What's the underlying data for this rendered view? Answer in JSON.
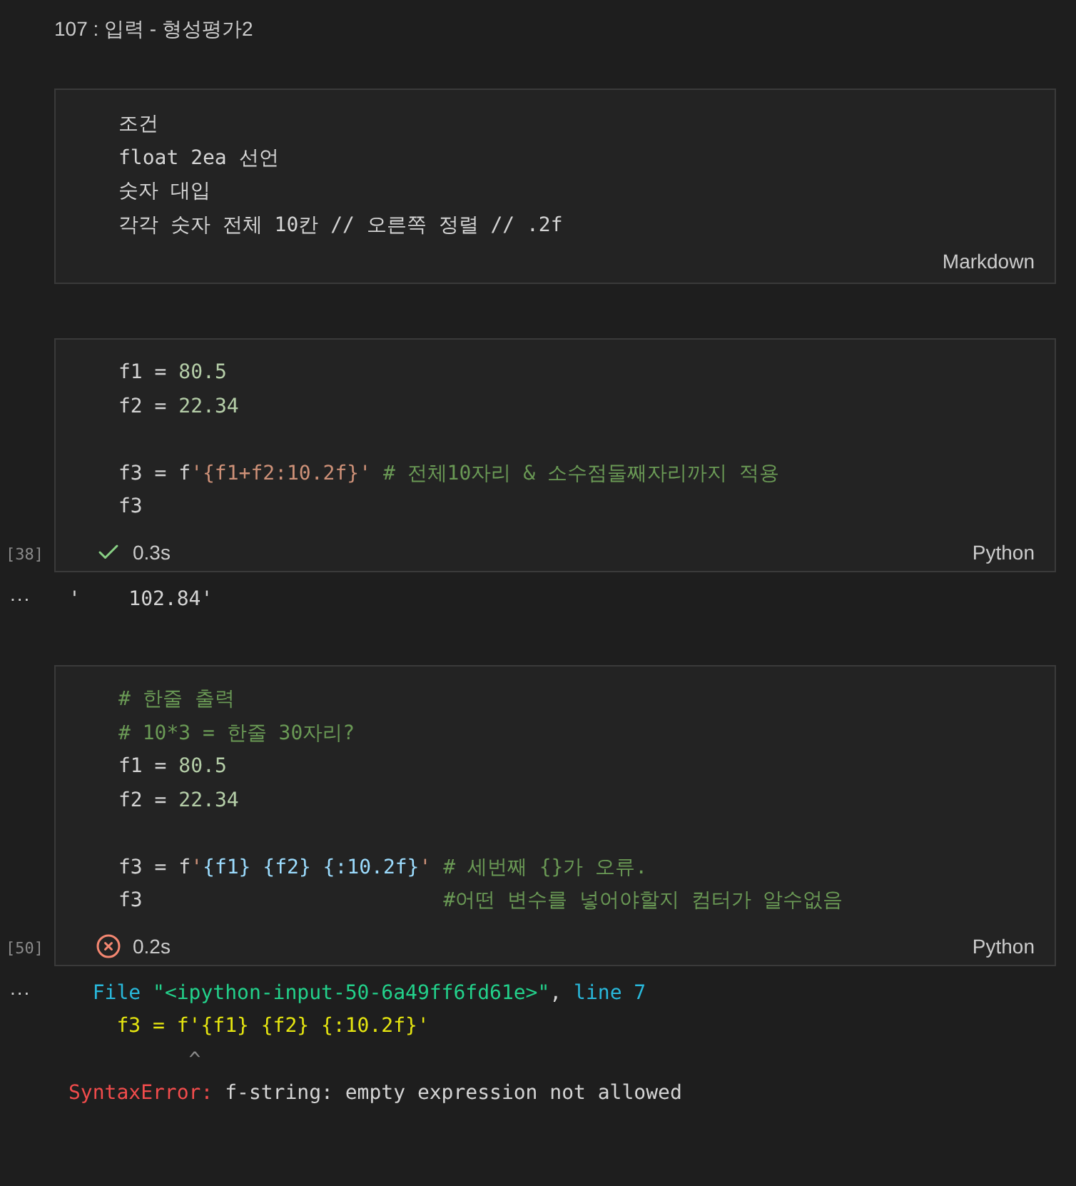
{
  "title": "107 : 입력 - 형성평가2",
  "cells": [
    {
      "kind": "markdown",
      "language": "Markdown",
      "lines": [
        {
          "kind": "code",
          "tokens": [
            {
              "kind": "text",
              "text": "조건"
            }
          ]
        },
        {
          "kind": "code",
          "tokens": [
            {
              "kind": "text",
              "text": "float 2ea 선언"
            }
          ]
        },
        {
          "kind": "code",
          "tokens": [
            {
              "kind": "text",
              "text": "숫자 대입"
            }
          ]
        },
        {
          "kind": "code",
          "tokens": [
            {
              "kind": "text",
              "text": "각각 숫자 전체 10칸 // 오른쪽 정렬 // .2f"
            }
          ]
        }
      ]
    },
    {
      "kind": "code",
      "language": "Python",
      "execution_count": "[38]",
      "result": {
        "kind": "success",
        "duration": "0.3s"
      },
      "lines": [
        {
          "kind": "code",
          "tokens": [
            {
              "kind": "text",
              "text": "f1 = "
            },
            {
              "kind": "number",
              "text": "80.5"
            }
          ]
        },
        {
          "kind": "code",
          "tokens": [
            {
              "kind": "text",
              "text": "f2 = "
            },
            {
              "kind": "number",
              "text": "22.34"
            }
          ]
        },
        {
          "kind": "blank"
        },
        {
          "kind": "code",
          "tokens": [
            {
              "kind": "text",
              "text": "f3 = f"
            },
            {
              "kind": "string",
              "text": "'{f1+f2:10.2f}' "
            },
            {
              "kind": "comment",
              "text": "# 전체10자리 & 소수점둘째자리까지 적용"
            }
          ]
        },
        {
          "kind": "code",
          "tokens": [
            {
              "kind": "text",
              "text": "f3"
            }
          ]
        }
      ],
      "output": {
        "marker": "...",
        "lines": [
          {
            "kind": "code",
            "tokens": [
              {
                "kind": "text",
                "text": "'    102.84'"
              }
            ]
          }
        ]
      }
    },
    {
      "kind": "code",
      "language": "Python",
      "execution_count": "[50]",
      "result": {
        "kind": "error",
        "duration": "0.2s"
      },
      "lines": [
        {
          "kind": "code",
          "tokens": [
            {
              "kind": "comment",
              "text": "# 한줄 출력"
            }
          ]
        },
        {
          "kind": "code",
          "tokens": [
            {
              "kind": "comment",
              "text": "# 10*3 = 한줄 30자리?"
            }
          ]
        },
        {
          "kind": "code",
          "tokens": [
            {
              "kind": "text",
              "text": "f1 = "
            },
            {
              "kind": "number",
              "text": "80.5"
            }
          ]
        },
        {
          "kind": "code",
          "tokens": [
            {
              "kind": "text",
              "text": "f2 = "
            },
            {
              "kind": "number",
              "text": "22.34"
            }
          ]
        },
        {
          "kind": "blank"
        },
        {
          "kind": "code",
          "tokens": [
            {
              "kind": "text",
              "text": "f3 = f"
            },
            {
              "kind": "string",
              "text": "'"
            },
            {
              "kind": "brace",
              "text": "{f1} {f2} {:10.2f}"
            },
            {
              "kind": "string",
              "text": "' "
            },
            {
              "kind": "comment",
              "text": "# 세번째 {}가 오류."
            }
          ]
        },
        {
          "kind": "code",
          "tokens": [
            {
              "kind": "text",
              "text": "f3                         "
            },
            {
              "kind": "comment",
              "text": "#어떤 변수를 넣어야할지 컴터가 알수없음"
            }
          ]
        }
      ],
      "output": {
        "marker": "...",
        "lines": [
          {
            "kind": "code",
            "tokens": [
              {
                "kind": "cyan",
                "text": "  File "
              },
              {
                "kind": "green",
                "text": "\"<ipython-input-50-6a49ff6fd61e>\""
              },
              {
                "kind": "text",
                "text": ", "
              },
              {
                "kind": "cyan",
                "text": "line 7"
              }
            ]
          },
          {
            "kind": "code",
            "tokens": [
              {
                "kind": "yellow",
                "text": "    f3 = f'{f1} {f2} {:10.2f}'"
              }
            ]
          },
          {
            "kind": "code",
            "tokens": [
              {
                "kind": "dim",
                "text": "          ^"
              }
            ]
          },
          {
            "kind": "code",
            "tokens": [
              {
                "kind": "red",
                "text": "SyntaxError:"
              },
              {
                "kind": "text",
                "text": " f-string: empty expression not allowed"
              }
            ]
          }
        ]
      }
    }
  ]
}
